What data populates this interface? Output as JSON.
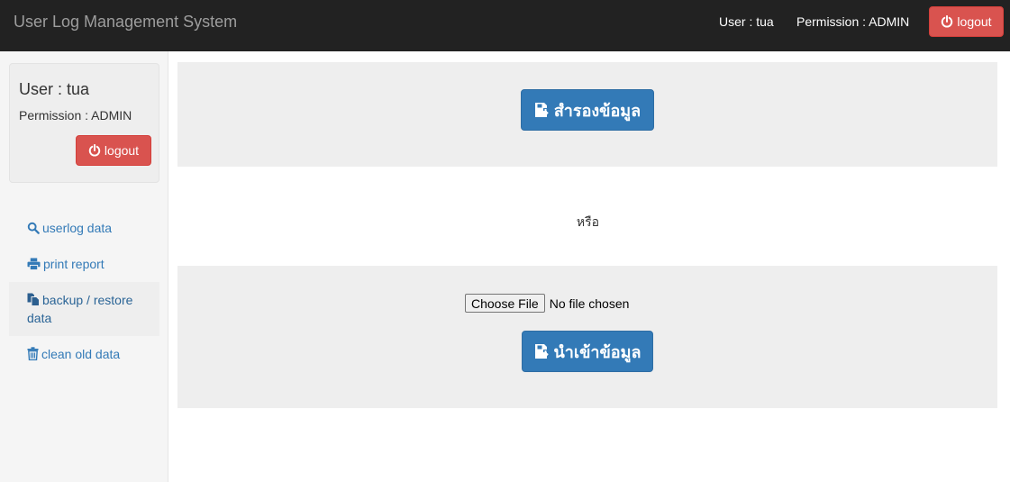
{
  "navbar": {
    "brand": "User Log Management System",
    "user_text": "User : tua",
    "permission_text": "Permission : ADMIN",
    "logout_label": "logout"
  },
  "sidebar": {
    "user": "User : tua",
    "permission": "Permission : ADMIN",
    "logout_label": "logout",
    "items": [
      {
        "label": "userlog data",
        "icon": "search-icon"
      },
      {
        "label": "print report",
        "icon": "print-icon"
      },
      {
        "label": "backup / restore data",
        "icon": "copy-icon",
        "active": true
      },
      {
        "label": "clean old data",
        "icon": "trash-icon"
      }
    ]
  },
  "main": {
    "backup_label": "สำรองข้อมูล",
    "or_text": "หรือ",
    "choose_file_label": "Choose File",
    "no_file_text": "No file chosen",
    "restore_label": "นำเข้าข้อมูล"
  },
  "colors": {
    "navbar_bg": "#222222",
    "danger": "#d9534f",
    "primary": "#337ab7",
    "link": "#337ab7",
    "panel_bg": "#eeeeee"
  }
}
